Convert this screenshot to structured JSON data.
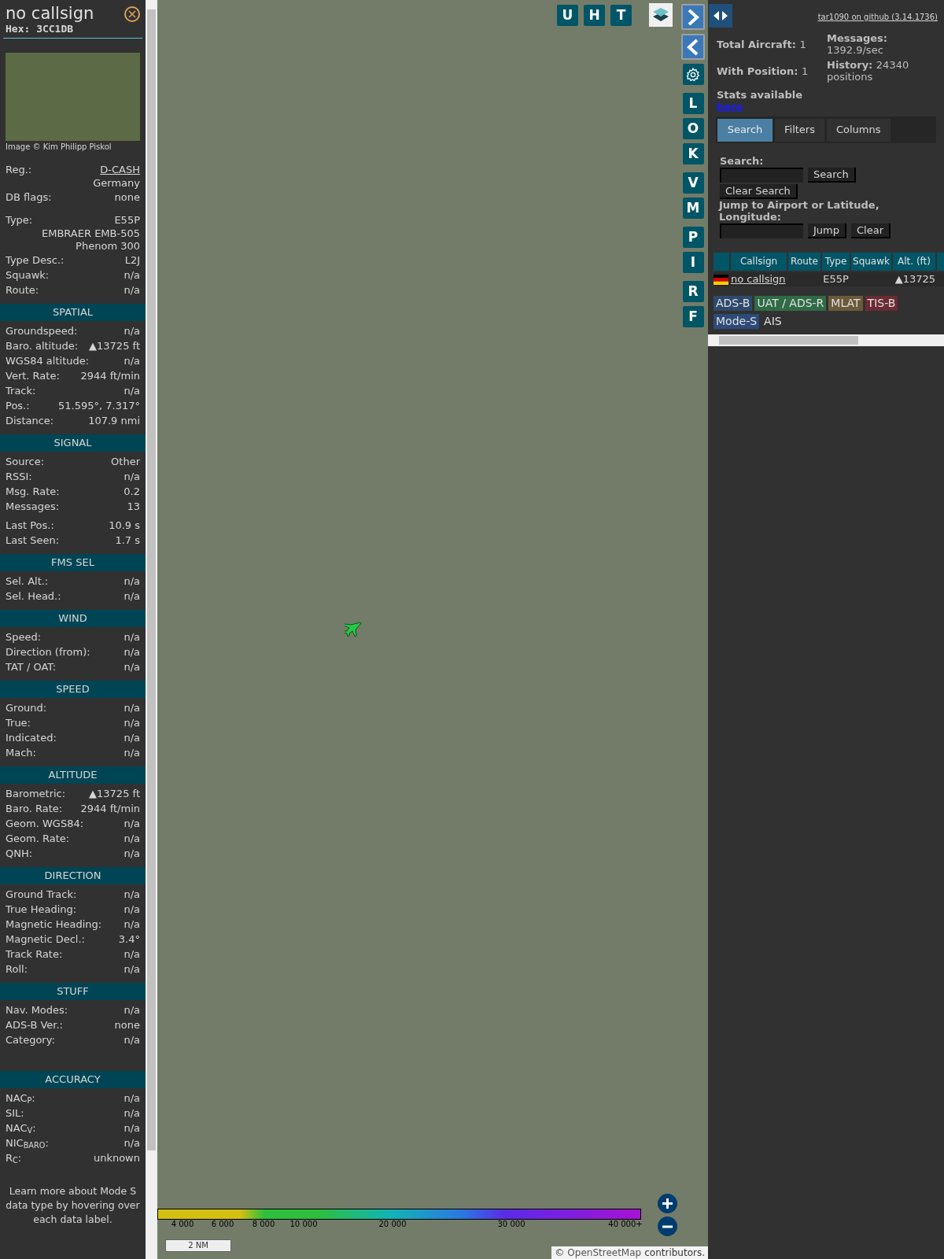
{
  "detail": {
    "title": "no callsign",
    "hex": "Hex: 3CC1DB",
    "image_credit": "Image © Kim Philipp Piskol",
    "rows": [
      {
        "kind": "link",
        "label": "Reg.:",
        "value": "D-CASH"
      },
      {
        "kind": "value",
        "value": "Germany"
      },
      {
        "kind": "pair",
        "label": "DB flags:",
        "value": "none"
      },
      {
        "kind": "pair",
        "label": "Type:",
        "value": "E55P"
      },
      {
        "kind": "value",
        "value": "EMBRAER EMB-505 Phenom 300"
      },
      {
        "kind": "pair",
        "label": "Type Desc.:",
        "value": "L2J"
      },
      {
        "kind": "pair",
        "label": "Squawk:",
        "value": "n/a"
      },
      {
        "kind": "pair",
        "label": "Route:",
        "value": "n/a"
      }
    ],
    "sections": [
      {
        "title": "SPATIAL",
        "rows": [
          {
            "label": "Groundspeed:",
            "value": "n/a"
          },
          {
            "label": "Baro. altitude:",
            "value": "▲13725 ft"
          },
          {
            "label": "WGS84 altitude:",
            "value": "n/a"
          },
          {
            "label": "Vert. Rate:",
            "value": "2944 ft/min"
          },
          {
            "label": "Track:",
            "value": "n/a"
          },
          {
            "label": "Pos.:",
            "value": "51.595°, 7.317°"
          },
          {
            "label": "Distance:",
            "value": "107.9 nmi"
          }
        ]
      },
      {
        "title": "SIGNAL",
        "rows": [
          {
            "label": "Source:",
            "value": "Other"
          },
          {
            "label": "RSSI:",
            "value": "n/a"
          },
          {
            "label": "Msg. Rate:",
            "value": "0.2"
          },
          {
            "label": "Messages:",
            "value": "13"
          },
          {
            "label": "Last Pos.:",
            "value": "10.9 s"
          },
          {
            "label": "Last Seen:",
            "value": "1.7 s"
          }
        ]
      },
      {
        "title": "FMS SEL",
        "rows": [
          {
            "label": "Sel. Alt.:",
            "value": "n/a"
          },
          {
            "label": "Sel. Head.:",
            "value": "n/a"
          }
        ]
      },
      {
        "title": "WIND",
        "rows": [
          {
            "label": "Speed:",
            "value": "n/a"
          },
          {
            "label": "Direction (from):",
            "value": "n/a"
          },
          {
            "label": "TAT / OAT:",
            "value": "n/a"
          }
        ]
      },
      {
        "title": "SPEED",
        "rows": [
          {
            "label": "Ground:",
            "value": "n/a"
          },
          {
            "label": "True:",
            "value": "n/a"
          },
          {
            "label": "Indicated:",
            "value": "n/a"
          },
          {
            "label": "Mach:",
            "value": "n/a"
          }
        ]
      },
      {
        "title": "ALTITUDE",
        "rows": [
          {
            "label": "Barometric:",
            "value": "▲13725 ft"
          },
          {
            "label": "Baro. Rate:",
            "value": "2944 ft/min"
          },
          {
            "label": "Geom. WGS84:",
            "value": "n/a"
          },
          {
            "label": "Geom. Rate:",
            "value": "n/a"
          },
          {
            "label": "QNH:",
            "value": "n/a"
          }
        ]
      },
      {
        "title": "DIRECTION",
        "rows": [
          {
            "label": "Ground Track:",
            "value": "n/a"
          },
          {
            "label": "True Heading:",
            "value": "n/a"
          },
          {
            "label": "Magnetic Heading:",
            "value": "n/a"
          },
          {
            "label": "Magnetic Decl.:",
            "value": "3.4°"
          },
          {
            "label": "Track Rate:",
            "value": "n/a"
          },
          {
            "label": "Roll:",
            "value": "n/a"
          }
        ]
      },
      {
        "title": "STUFF",
        "rows": [
          {
            "label": "Nav. Modes:",
            "value": "n/a"
          },
          {
            "label": "ADS-B Ver.:",
            "value": "none"
          },
          {
            "label": "Category:",
            "value": "n/a"
          }
        ]
      },
      {
        "title": "ACCURACY",
        "rows": [
          {
            "label": "NAC$_{P}$:",
            "value": "n/a"
          },
          {
            "label": "SIL:",
            "value": "n/a"
          },
          {
            "label": "NAC$_{V}$:",
            "value": "n/a"
          },
          {
            "label": "NIC$_{BARO}$:",
            "value": "n/a"
          },
          {
            "label": "R$_{C}$:",
            "value": "unknown"
          }
        ]
      }
    ],
    "footer_note": "Learn more about Mode S data type by hovering over each data label."
  },
  "map": {
    "top_buttons": [
      "U",
      "H",
      "T"
    ],
    "side_buttons": [
      {
        "kind": "arrow_right"
      },
      {
        "kind": "arrow_left"
      },
      {
        "kind": "gear"
      },
      {
        "kind": "letter",
        "label": "L"
      },
      {
        "kind": "letter",
        "label": "O"
      },
      {
        "kind": "letter",
        "label": "K"
      },
      {
        "kind": "letter",
        "label": "V"
      },
      {
        "kind": "letter",
        "label": "M"
      },
      {
        "kind": "letter",
        "label": "P"
      },
      {
        "kind": "letter",
        "label": "I"
      },
      {
        "kind": "letter",
        "label": "R"
      },
      {
        "kind": "letter",
        "label": "F"
      }
    ],
    "legend_ticks": [
      "4 000",
      "6 000",
      "8 000",
      "10 000",
      "20 000",
      "30 000",
      "40 000+"
    ],
    "scale": "2 NM",
    "attribution_prefix": "©",
    "attribution_link": "OpenStreetMap",
    "attribution_suffix": "contributors."
  },
  "panel": {
    "github_link": "tar1090 on github (3.14.1736)",
    "stats": [
      {
        "label": "Total Aircraft:",
        "value": "1"
      },
      {
        "label": "With Position:",
        "value": "1"
      },
      {
        "label": "Messages:",
        "value": "1392.9/sec"
      },
      {
        "label": "History:",
        "value": "24340 positions"
      }
    ],
    "stats_text": "Stats available",
    "stats_link": "here",
    "tabs": [
      {
        "label": "Search",
        "selected": true
      },
      {
        "label": "Filters",
        "selected": false
      },
      {
        "label": "Columns",
        "selected": false
      }
    ],
    "search_label": "Search:",
    "search_button": "Search",
    "clear_search_button": "Clear Search",
    "jump_label": "Jump to Airport or Latitude, Longitude:",
    "jump_button": "Jump",
    "clear_button": "Clear",
    "table": {
      "columns": [
        "Callsign",
        "Route",
        "Type",
        "Squawk",
        "Alt. (ft)"
      ],
      "rows": [
        {
          "callsign": "no callsign",
          "type": "E55P",
          "altitude": "▲13725"
        }
      ]
    },
    "sources": [
      {
        "label": "ADS-B",
        "color": "#2e4a6b"
      },
      {
        "label": "UAT / ADS-R",
        "color": "#2f6b45"
      },
      {
        "label": "MLAT",
        "color": "#6b5a3a"
      },
      {
        "label": "TIS-B",
        "color": "#6b2a34"
      },
      {
        "label": "Mode-S",
        "color": "#2d4a78"
      },
      {
        "label": "AIS",
        "color": "#313131"
      }
    ]
  }
}
